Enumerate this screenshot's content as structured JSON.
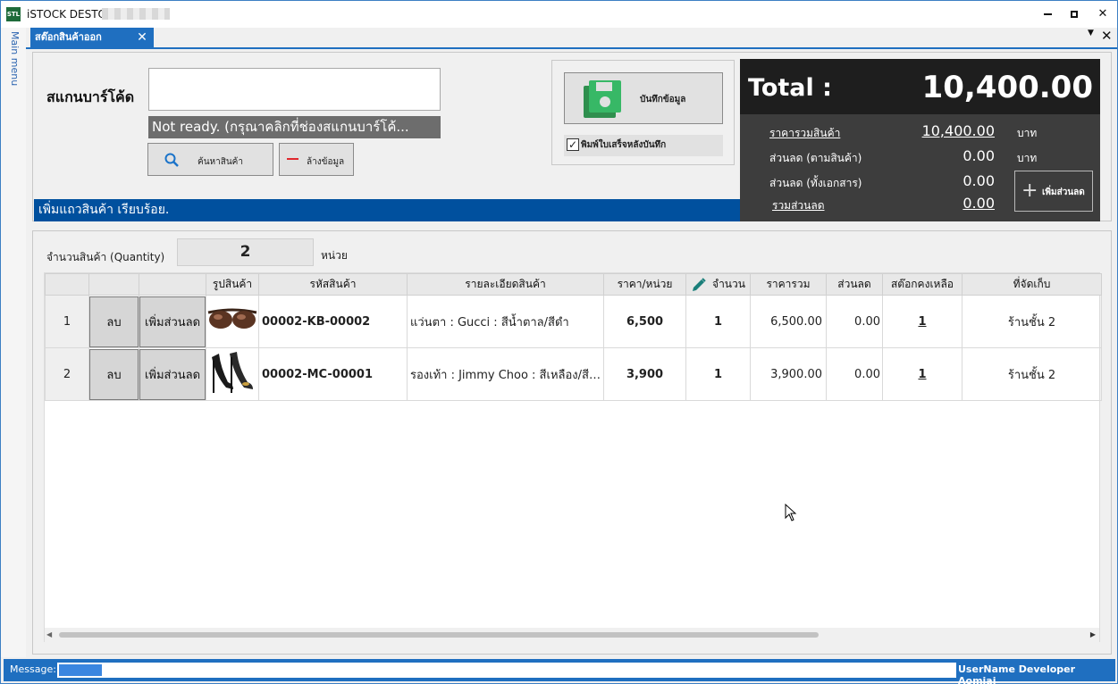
{
  "window": {
    "title": "iSTOCK DESTOP",
    "logo_text": "STL"
  },
  "side_menu": {
    "label": "Main menu"
  },
  "tab": {
    "label": "สต๊อกสินค้าออก"
  },
  "scan": {
    "label": "สแกนบาร์โค้ด",
    "value": "",
    "status": "Not ready. (กรุณาคลิกที่ช่องสแกนบาร์โค้...",
    "search_label": "ค้นหาสินค้า",
    "clear_label": "ล้างข้อมูล"
  },
  "save": {
    "button_label": "บันทึกข้อมูล",
    "print_label": "พิมพ์ใบเสร็จหลังบันทึก",
    "print_checked": true
  },
  "message_line": "เพิ่มแถวสินค้า เรียบร้อย.",
  "totals": {
    "total_label": "Total :",
    "total_value": "10,400.00",
    "rows": [
      {
        "label": "ราคารวมสินค้า",
        "value": "10,400.00",
        "unit": "บาท"
      },
      {
        "label": "ส่วนลด (ตามสินค้า)",
        "value": "0.00",
        "unit": "บาท"
      },
      {
        "label": "ส่วนลด (ทั้งเอกสาร)",
        "value": "0.00",
        "unit": ""
      },
      {
        "label": "รวมส่วนลด",
        "value": "0.00",
        "unit": ""
      }
    ],
    "add_discount_label": "เพิ่มส่วนลด"
  },
  "quantity": {
    "label": "จำนวนสินค้า (Quantity)",
    "value": "2",
    "unit": "หน่วย"
  },
  "table": {
    "columns": [
      "",
      "",
      "",
      "รูปสินค้า",
      "รหัสสินค้า",
      "รายละเอียดสินค้า",
      "ราคา/หน่วย",
      "จำนวน",
      "ราคารวม",
      "ส่วนลด",
      "สต๊อกคงเหลือ",
      "ที่จัดเก็บ"
    ],
    "rows": [
      {
        "index": "1",
        "delete_label": "ลบ",
        "discount_label": "เพิ่มส่วนลด",
        "image": "sunglasses",
        "code": "00002-KB-00002",
        "description": "แว่นตา : Gucci : สีน้ำตาล/สีดำ",
        "price": "6,500",
        "qty": "1",
        "total": "6,500.00",
        "discount": "0.00",
        "stock": "1",
        "location": "ร้านชั้น 2"
      },
      {
        "index": "2",
        "delete_label": "ลบ",
        "discount_label": "เพิ่มส่วนลด",
        "image": "high-heels",
        "code": "00002-MC-00001",
        "description": "รองเท้า : Jimmy Choo : สีเหลือง/สีทอง",
        "price": "3,900",
        "qty": "1",
        "total": "3,900.00",
        "discount": "0.00",
        "stock": "1",
        "location": "ร้านชั้น 2"
      }
    ]
  },
  "bottom": {
    "message_label": "Message:",
    "user": "UserName Developer Aomjai"
  },
  "colors": {
    "accent": "#1f6fc0",
    "status_blue": "#00509e",
    "total_dark": "#1e1e1e",
    "save_green": "#2eaa5c"
  }
}
